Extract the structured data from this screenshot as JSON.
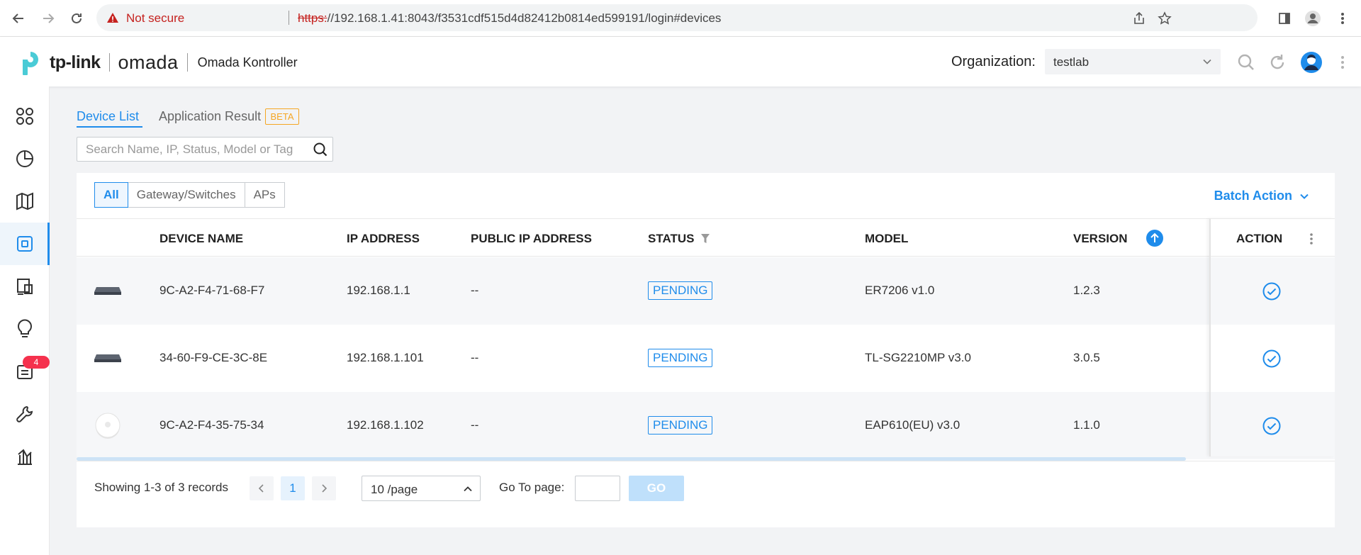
{
  "browser": {
    "security_label": "Not secure",
    "url_scheme": "https:",
    "url_rest": "//192.168.1.41:8043/f3531cdf515d4d82412b0814ed599191/login#devices"
  },
  "header": {
    "brand": "tp-link",
    "product": "omada",
    "app_name": "Omada Kontroller",
    "org_label": "Organization:",
    "org_value": "testlab"
  },
  "sidebar": {
    "alerts_badge": "4"
  },
  "tabs": {
    "device_list": "Device List",
    "application_result": "Application Result",
    "beta": "BETA"
  },
  "search": {
    "placeholder": "Search Name, IP, Status, Model or Tag"
  },
  "filters": {
    "all": "All",
    "gateway_switches": "Gateway/Switches",
    "aps": "APs"
  },
  "batch_action": "Batch Action",
  "table": {
    "headers": {
      "device_name": "DEVICE NAME",
      "ip_address": "IP ADDRESS",
      "public_ip": "PUBLIC IP ADDRESS",
      "status": "STATUS",
      "model": "MODEL",
      "version": "VERSION",
      "action": "ACTION"
    },
    "rows": [
      {
        "name": "9C-A2-F4-71-68-F7",
        "ip": "192.168.1.1",
        "public_ip": "--",
        "status": "PENDING",
        "model": "ER7206 v1.0",
        "version": "1.2.3"
      },
      {
        "name": "34-60-F9-CE-3C-8E",
        "ip": "192.168.1.101",
        "public_ip": "--",
        "status": "PENDING",
        "model": "TL-SG2210MP v3.0",
        "version": "3.0.5"
      },
      {
        "name": "9C-A2-F4-35-75-34",
        "ip": "192.168.1.102",
        "public_ip": "--",
        "status": "PENDING",
        "model": "EAP610(EU) v3.0",
        "version": "1.1.0"
      }
    ]
  },
  "pagination": {
    "summary": "Showing 1-3 of 3 records",
    "current_page": "1",
    "per_page": "10 /page",
    "goto_label": "Go To page:",
    "goto_value": "",
    "go_button": "GO"
  },
  "colors": {
    "accent": "#1f8ceb",
    "beta": "#f5a623",
    "badge": "#f5314d"
  }
}
